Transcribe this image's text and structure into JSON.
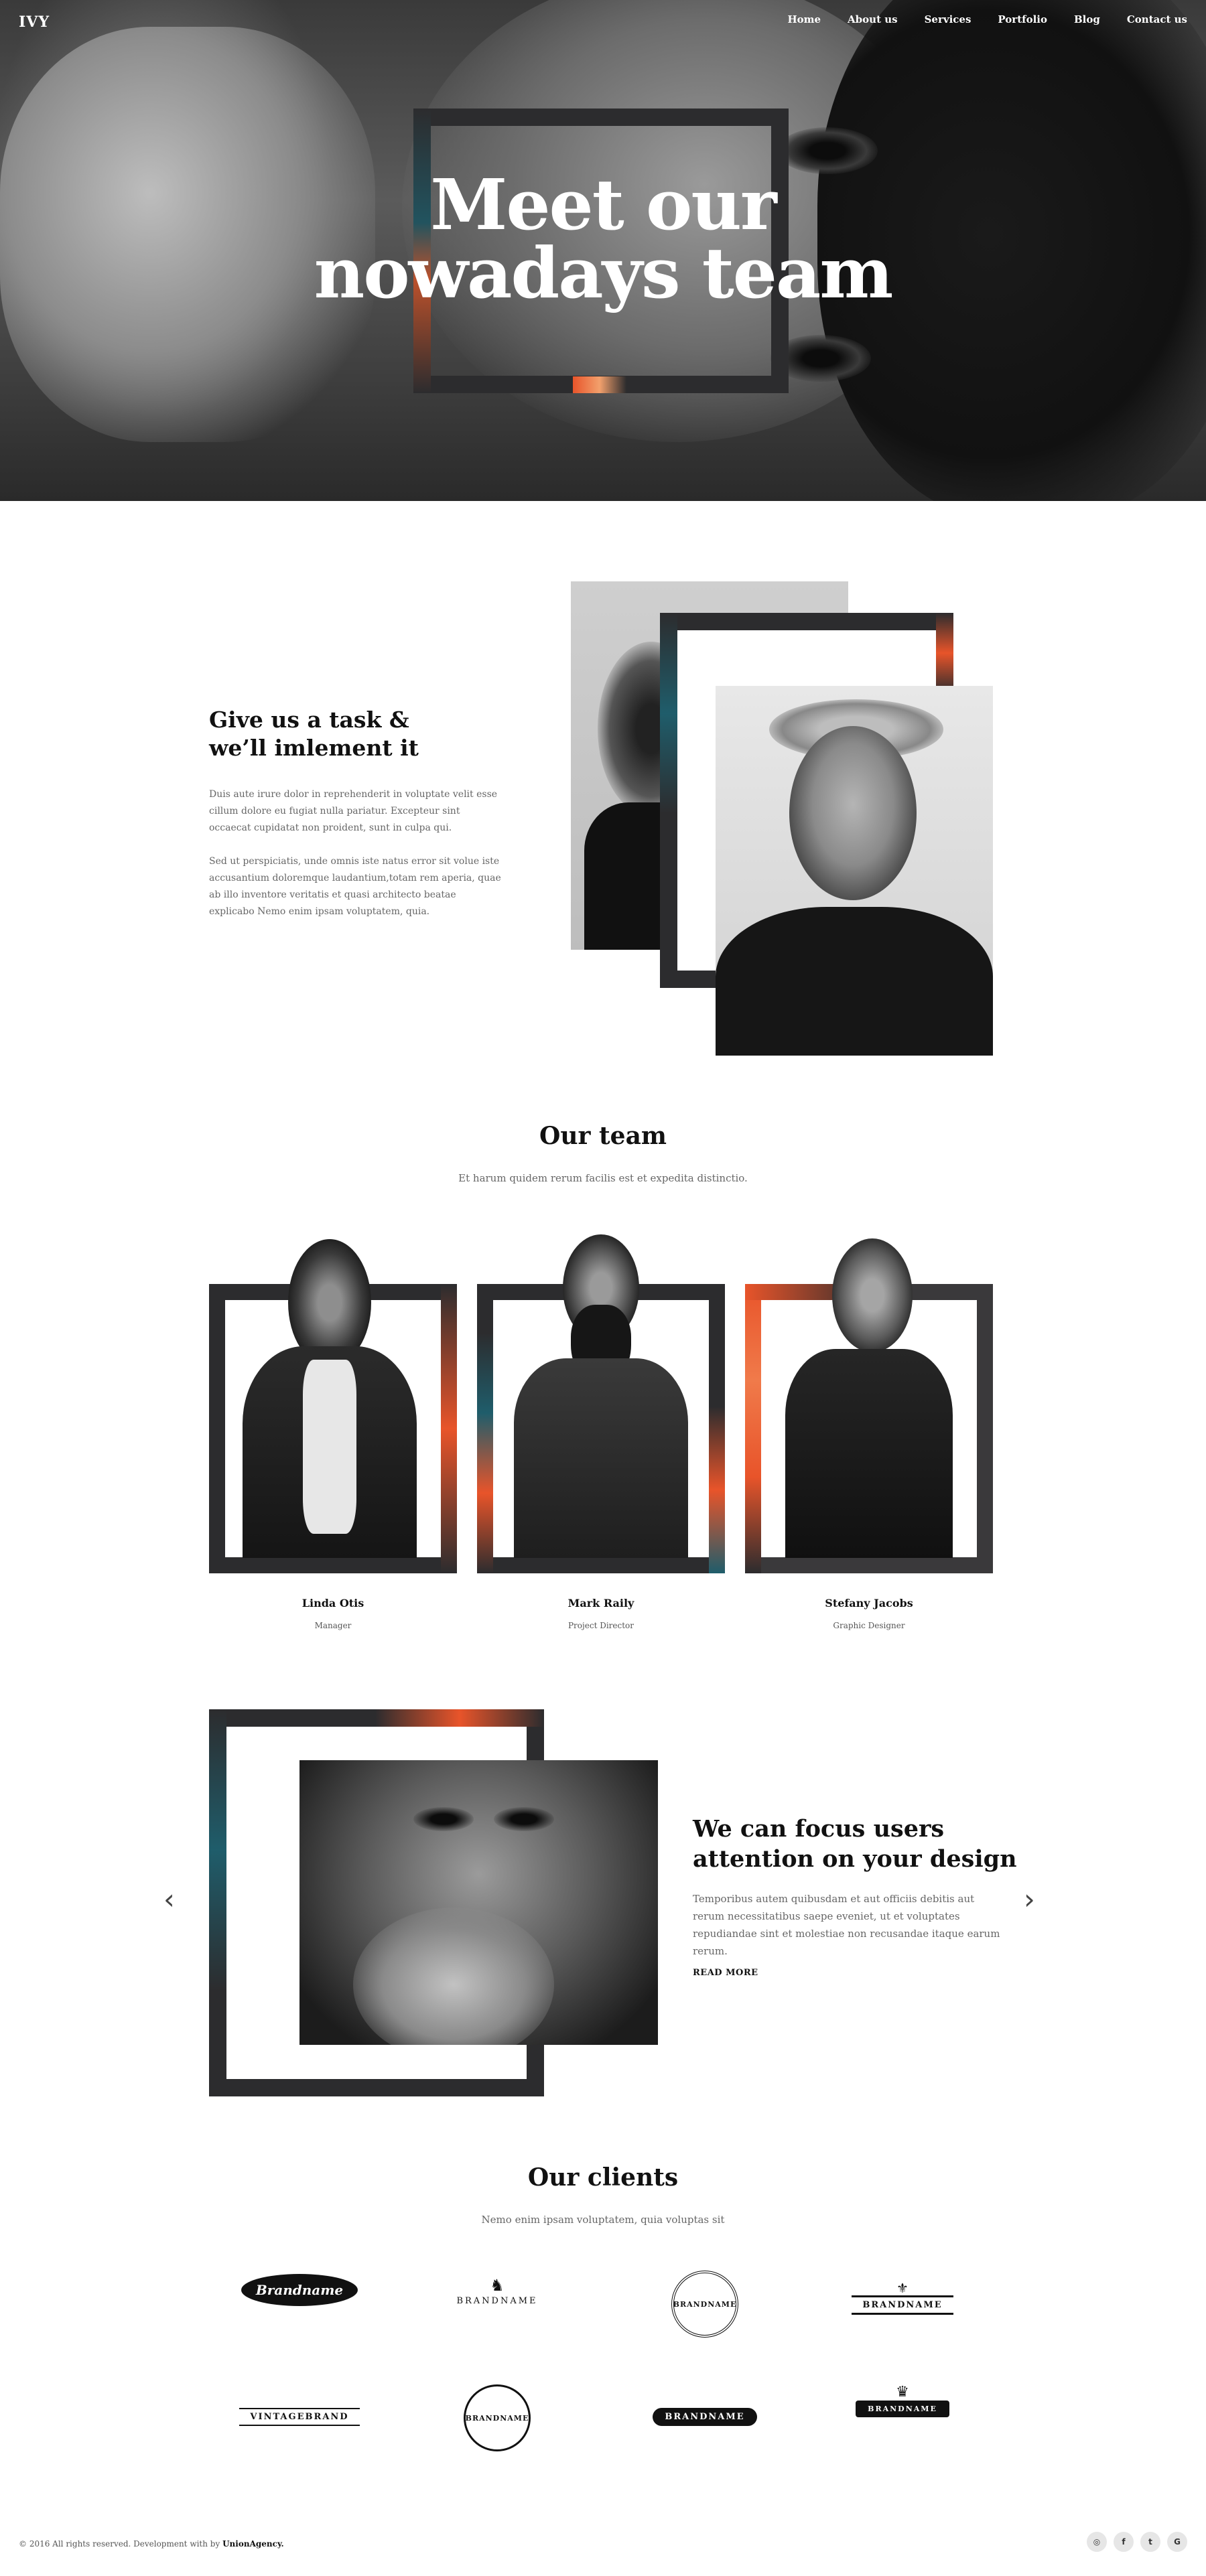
{
  "brand": {
    "logo": "IVY"
  },
  "nav": {
    "items": [
      "Home",
      "About us",
      "Services",
      "Portfolio",
      "Blog",
      "Contact us"
    ]
  },
  "hero": {
    "title_line1": "Meet our",
    "title_line2": "nowadays team"
  },
  "about": {
    "title_line1": "Give us a task &",
    "title_line2": "we’ll imlement it",
    "para1": "Duis aute irure dolor in reprehenderit in voluptate velit esse cillum dolore eu fugiat nulla pariatur. Excepteur sint occaecat cupidatat non proident, sunt in culpa qui.",
    "para2": "Sed ut perspiciatis, unde omnis iste natus error sit volue iste accusantium doloremque laudantium,totam rem aperia, quae ab illo inventore veritatis et quasi architecto beatae explicabo Nemo enim ipsam voluptatem, quia."
  },
  "team": {
    "title": "Our team",
    "subtitle": "Et harum quidem rerum facilis est et expedita distinctio.",
    "members": [
      {
        "name": "Linda Otis",
        "role": "Manager"
      },
      {
        "name": "Mark Raily",
        "role": "Project Director"
      },
      {
        "name": "Stefany Jacobs",
        "role": "Graphic Designer"
      }
    ]
  },
  "focus": {
    "title_line1": "We can focus users",
    "title_line2": "attention on your design",
    "text": "Temporibus autem quibusdam et aut officiis debitis aut rerum necessitatibus saepe eveniet, ut et voluptates repudiandae sint et molestiae non recusandae itaque earum rerum.",
    "read_more": "READ MORE",
    "prev_icon": "‹",
    "next_icon": "›"
  },
  "clients": {
    "title": "Our clients",
    "subtitle": "Nemo enim ipsam voluptatem, quia voluptas sit",
    "logos": [
      "Brandname",
      "BRANDNAME",
      "BRANDNAME",
      "BRANDNAME",
      "VINTAGEBRAND",
      "BRANDNAME",
      "BRANDNAME",
      "BRANDNAME"
    ]
  },
  "footer": {
    "copyright": "© 2016 All rights reserved. Development with by",
    "agency": "UnionAgency.",
    "social": [
      "instagram-icon",
      "facebook-icon",
      "twitter-icon",
      "google-icon"
    ],
    "social_glyphs": [
      "◎",
      "f",
      "t",
      "G"
    ]
  },
  "colors": {
    "frame": "#2c2c2e",
    "accent_orange": "#e8542a",
    "accent_teal": "#1f5d6b"
  }
}
